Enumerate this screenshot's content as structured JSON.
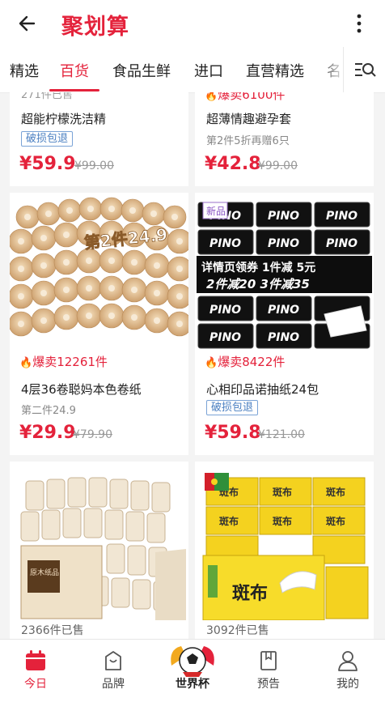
{
  "header": {
    "brand": "聚划算",
    "back_icon": "back-arrow-icon",
    "more_icon": "more-vertical-icon"
  },
  "tabs": [
    {
      "label": "精选",
      "active": false
    },
    {
      "label": "百货",
      "active": true
    },
    {
      "label": "食品生鲜",
      "active": false
    },
    {
      "label": "进口",
      "active": false
    },
    {
      "label": "直营精选",
      "active": false
    },
    {
      "label": "名",
      "active": false
    }
  ],
  "products": [
    {
      "sales_text": "271件已售",
      "title": "超能柠檬洗洁精",
      "tag": "破损包退",
      "price": "¥59.9",
      "old_price": "¥99.00"
    },
    {
      "sales_text": "爆卖6100件",
      "title": "超薄情趣避孕套",
      "subtitle": "第2件5折再赠6只",
      "price": "¥42.8",
      "old_price": "¥99.00"
    },
    {
      "sales_text": "爆卖12261件",
      "title": "4层36卷聪妈本色卷纸",
      "subtitle": "第二件24.9",
      "price": "¥29.9",
      "old_price": "¥79.90",
      "image_text": "第2件24.9"
    },
    {
      "sales_text": "爆卖8422件",
      "title": "心相印品诺抽纸24包",
      "tag": "破损包退",
      "price": "¥59.8",
      "old_price": "¥121.00",
      "badge": "新品",
      "image_line1": "详情页领券 1件减 5元",
      "image_line2": "2件减20 3件减35",
      "brand_text": "PINO"
    },
    {
      "sales_text": "2366件已售",
      "brand_text": "原木纸品"
    },
    {
      "sales_text": "3092件已售",
      "brand_text": "斑布"
    }
  ],
  "bottom_nav": [
    {
      "label": "今日",
      "icon": "calendar-icon",
      "active": true
    },
    {
      "label": "品牌",
      "icon": "shopping-bag-icon",
      "active": false
    },
    {
      "label": "世界杯",
      "icon": "soccer-ball-icon",
      "active": false
    },
    {
      "label": "预告",
      "icon": "bookmark-icon",
      "active": false
    },
    {
      "label": "我的",
      "icon": "user-icon",
      "active": false
    }
  ],
  "colors": {
    "accent": "#e4223b",
    "tag_blue": "#4a7fc1"
  }
}
